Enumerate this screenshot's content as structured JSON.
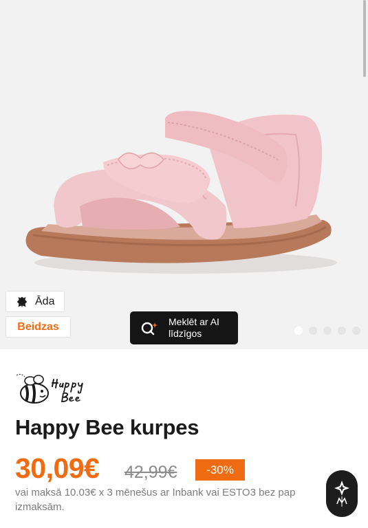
{
  "gallery": {
    "badges": {
      "material_icon": "leather-icon",
      "material_label": "Āda",
      "ending_label": "Beidzas"
    },
    "ai_search": {
      "icon": "ai-search-icon",
      "line1": "Meklēt ar AI",
      "line2": "līdzīgos"
    },
    "dots_count": 5,
    "active_dot": 0
  },
  "product": {
    "brand": "Happy Bee",
    "title": "Happy Bee kurpes",
    "price": "30,09€",
    "old_price": "42,99€",
    "discount": "-30%",
    "installment_line1": "vai maksā 10.03€ x 3 mēnešus ar Inbank vai ESTO3 bez pap",
    "installment_line2": "izmaksām."
  },
  "colors": {
    "accent": "#ef6c12",
    "dark": "#151515",
    "shoe_pink": "#efc3c7",
    "sole": "#b7795a"
  }
}
